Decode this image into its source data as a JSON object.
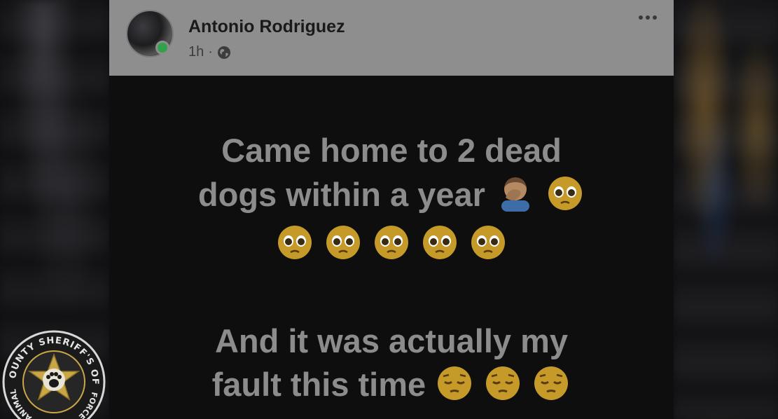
{
  "post": {
    "author": "Antonio Rodriguez",
    "time": "1h",
    "separator": "·",
    "audience_icon": "globe-icon",
    "menu_icon": "more-options-icon",
    "paragraph1": {
      "line1": "Came home to 2 dead",
      "line2": "dogs within a year"
    },
    "paragraph2": {
      "line1": "And it was actually my",
      "line2": "fault this time"
    }
  },
  "badge": {
    "text_top": "LEE COUNTY SHERIFF'S OFFICE",
    "text_left": "ANIMAL",
    "text_right": "FORCE",
    "icon": "sheriff-star-paw-icon"
  },
  "colors": {
    "header_bg": "#8e8e8e",
    "body_bg": "#0e0e0f",
    "text": "#8c8c8c",
    "online": "#31a24c",
    "badge_gold": "#c9a646"
  }
}
